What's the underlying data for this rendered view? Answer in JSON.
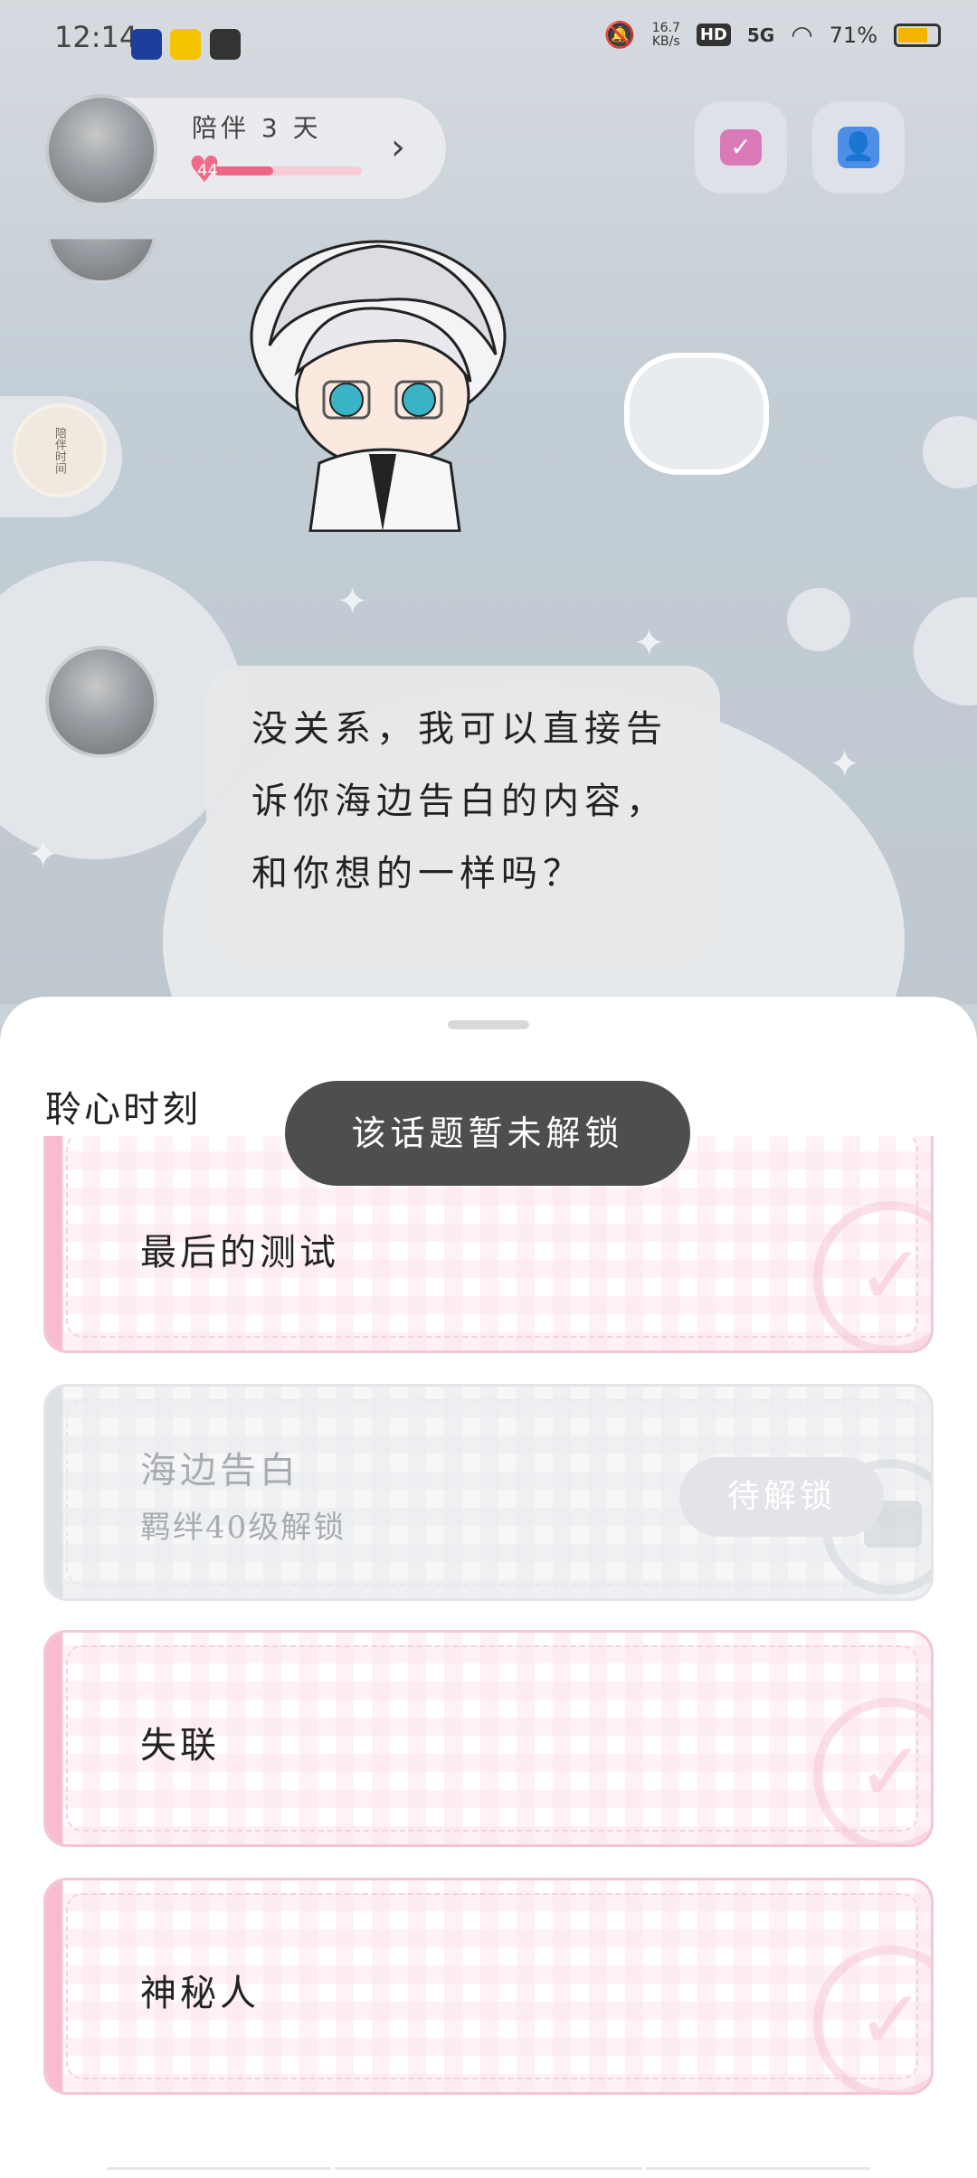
{
  "status_bar": {
    "time": "12:14",
    "net_speed_value": "16.7",
    "net_speed_unit": "KB/s",
    "hd": "HD",
    "network": "5G",
    "battery": "71%"
  },
  "header": {
    "companion_label": "陪伴 3 天",
    "affection_level": "44",
    "affection_progress": 0.4
  },
  "chat": {
    "message": "没关系，我可以直接告诉你海边告白的内容，和你想的一样吗？"
  },
  "floating_badge_text": "陪伴时间",
  "sheet": {
    "title": "聆心时刻",
    "toast": "该话题暂未解锁",
    "topics": [
      {
        "title": "最后的测试",
        "locked": false
      },
      {
        "title": "海边告白",
        "subtitle": "羁绊40级解锁",
        "button": "待解锁",
        "locked": true
      },
      {
        "title": "失联",
        "locked": false
      },
      {
        "title": "神秘人",
        "locked": false
      }
    ]
  },
  "colors": {
    "accent_pink": "#ee6585",
    "toast_bg": "#4d4e50",
    "card_border": "#f3c6d3"
  }
}
